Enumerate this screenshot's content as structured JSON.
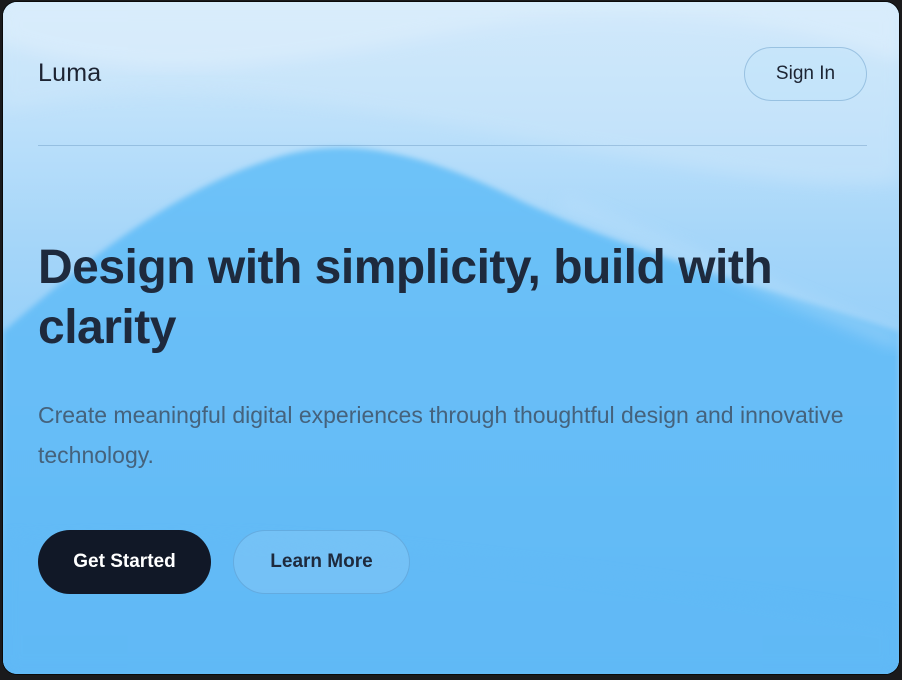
{
  "header": {
    "brand": "Luma",
    "signin_label": "Sign In"
  },
  "hero": {
    "title": "Design with simplicity, build with clarity",
    "subtitle": "Create meaningful digital experiences through thoughtful design and innovative technology."
  },
  "cta": {
    "primary_label": "Get Started",
    "secondary_label": "Learn More"
  },
  "colors": {
    "background_base": "#63bbf7",
    "background_light": "#d6ecfb",
    "primary_button": "#111827",
    "heading_text": "#1e2a3d",
    "body_text": "#45627c"
  }
}
